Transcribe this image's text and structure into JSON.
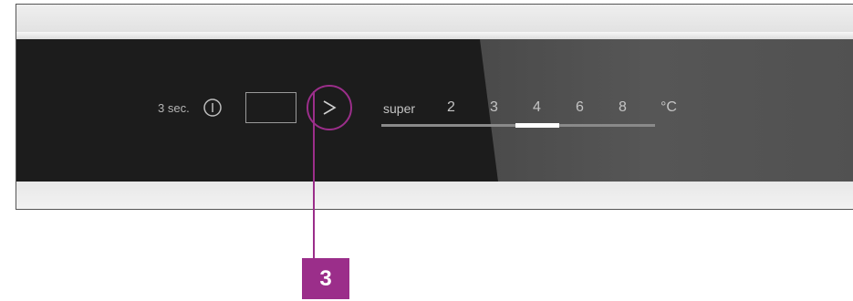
{
  "panel": {
    "duration_label": "3 sec.",
    "power_icon": "power-icon",
    "next_icon": "chevron-right-icon",
    "temperature": {
      "super_label": "super",
      "settings": [
        "2",
        "3",
        "4",
        "6",
        "8"
      ],
      "unit": "°C",
      "selected": "4"
    }
  },
  "callout": {
    "number": "3"
  },
  "colors": {
    "accent": "#9b2e8a",
    "glass": "#1c1c1c",
    "label": "#c4c4c4"
  }
}
